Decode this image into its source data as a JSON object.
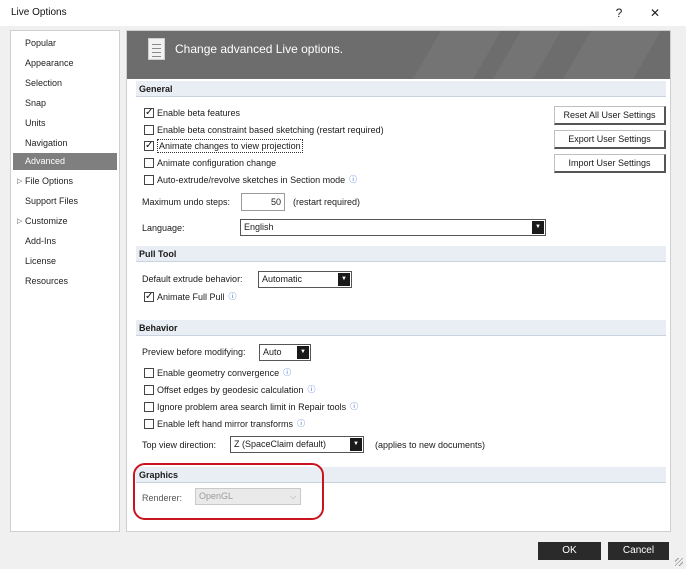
{
  "window": {
    "title": "Live Options",
    "help_label": "?",
    "close_label": "✕"
  },
  "nav": {
    "items": [
      {
        "label": "Popular"
      },
      {
        "label": "Appearance"
      },
      {
        "label": "Selection"
      },
      {
        "label": "Snap"
      },
      {
        "label": "Units"
      },
      {
        "label": "Navigation"
      },
      {
        "label": "Advanced",
        "active": true
      },
      {
        "label": "File Options",
        "expander": true
      },
      {
        "label": "Support Files"
      },
      {
        "label": "Customize",
        "expander": true
      },
      {
        "label": "Add-Ins"
      },
      {
        "label": "License"
      },
      {
        "label": "Resources"
      }
    ],
    "expander_glyph": "▷"
  },
  "header": {
    "title": "Change advanced Live options."
  },
  "general": {
    "title": "General",
    "checkboxes": [
      {
        "label": "Enable beta features",
        "checked": true
      },
      {
        "label": "Enable beta constraint based sketching (restart required)",
        "checked": false
      },
      {
        "label": "Animate changes to view projection",
        "checked": true,
        "focused": true
      },
      {
        "label": "Animate configuration change",
        "checked": false
      },
      {
        "label": "Auto-extrude/revolve sketches in Section mode",
        "checked": false,
        "info": true
      }
    ],
    "undo_label": "Maximum undo steps:",
    "undo_value": "50",
    "undo_note": "(restart required)",
    "language_label": "Language:",
    "language_value": "English",
    "buttons": {
      "reset": "Reset All User Settings",
      "export": "Export User Settings",
      "import": "Import User Settings"
    }
  },
  "pull_tool": {
    "title": "Pull Tool",
    "extrude_label": "Default extrude behavior:",
    "extrude_value": "Automatic",
    "animate_label": "Animate Full Pull",
    "animate_checked": true
  },
  "behavior": {
    "title": "Behavior",
    "preview_label": "Preview before modifying:",
    "preview_value": "Auto",
    "checkboxes": [
      {
        "label": "Enable geometry convergence",
        "checked": false
      },
      {
        "label": "Offset edges by geodesic calculation",
        "checked": false
      },
      {
        "label": "Ignore problem area search limit in Repair tools",
        "checked": false
      },
      {
        "label": "Enable left hand mirror transforms",
        "checked": false
      }
    ],
    "top_view_label": "Top view direction:",
    "top_view_value": "Z (SpaceClaim default)",
    "top_view_note": "(applies to new documents)"
  },
  "graphics": {
    "title": "Graphics",
    "renderer_label": "Renderer:",
    "renderer_value": "OpenGL"
  },
  "footer": {
    "ok": "OK",
    "cancel": "Cancel"
  },
  "icons": {
    "info": "ⓘ",
    "dropdown": "▼",
    "dropdown_disabled": "⌵"
  },
  "colors": {
    "active_nav": "#7f7f7f",
    "header_bg": "#6d6d6d",
    "highlight_border": "#c8141e",
    "info_icon": "#3e6fd0"
  }
}
